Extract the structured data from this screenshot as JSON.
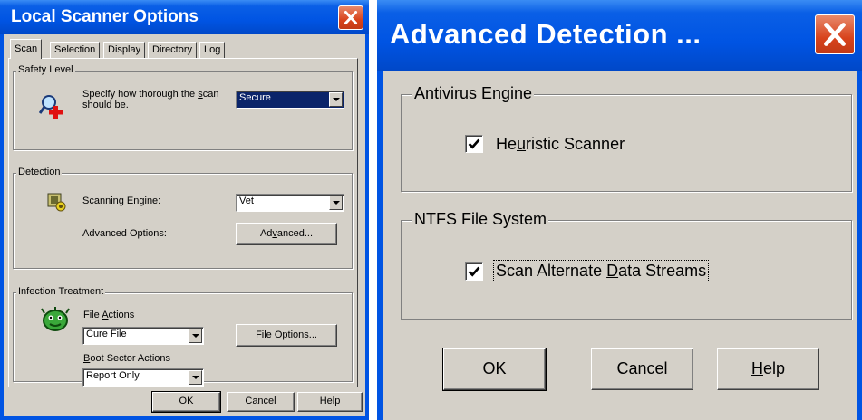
{
  "left": {
    "title": "Local Scanner Options",
    "tabs": [
      "Scan",
      "Selection",
      "Display",
      "Directory",
      "Log"
    ],
    "safety": {
      "legend": "Safety Level",
      "desc_prefix": "Specify how thorough the ",
      "desc_hot": "s",
      "desc_suffix": "can",
      "desc_line2": "should be.",
      "value": "Secure"
    },
    "detection": {
      "legend": "Detection",
      "engine_label": "Scanning Engine:",
      "engine_value": "Vet",
      "advanced_label": "Advanced Options:",
      "advanced_btn_pre": "Ad",
      "advanced_btn_hot": "v",
      "advanced_btn_post": "anced..."
    },
    "treatment": {
      "legend": "Infection Treatment",
      "file_actions_pre": "File ",
      "file_actions_hot": "A",
      "file_actions_post": "ctions",
      "file_actions_value": "Cure File",
      "file_options_hot": "F",
      "file_options_post": "ile Options...",
      "boot_hot": "B",
      "boot_post": "oot Sector Actions",
      "boot_value": "Report Only"
    },
    "buttons": {
      "ok": "OK",
      "cancel": "Cancel",
      "help": "Help"
    }
  },
  "right": {
    "title": "Advanced Detection ...",
    "antivirus": {
      "legend": "Antivirus Engine",
      "heuristic_pre": "He",
      "heuristic_hot": "u",
      "heuristic_post": "ristic Scanner",
      "heuristic_checked": true
    },
    "ntfs": {
      "legend": "NTFS File System",
      "ads_pre": "Scan Alternate ",
      "ads_hot": "D",
      "ads_post": "ata Streams",
      "ads_checked": true
    },
    "buttons": {
      "ok": "OK",
      "cancel": "Cancel",
      "help_hot": "H",
      "help_post": "elp"
    }
  },
  "colors": {
    "title_blue": "#0054e3",
    "dialog_face": "#d4d0c8",
    "close_red": "#d8431c",
    "selection": "#0a246a"
  }
}
